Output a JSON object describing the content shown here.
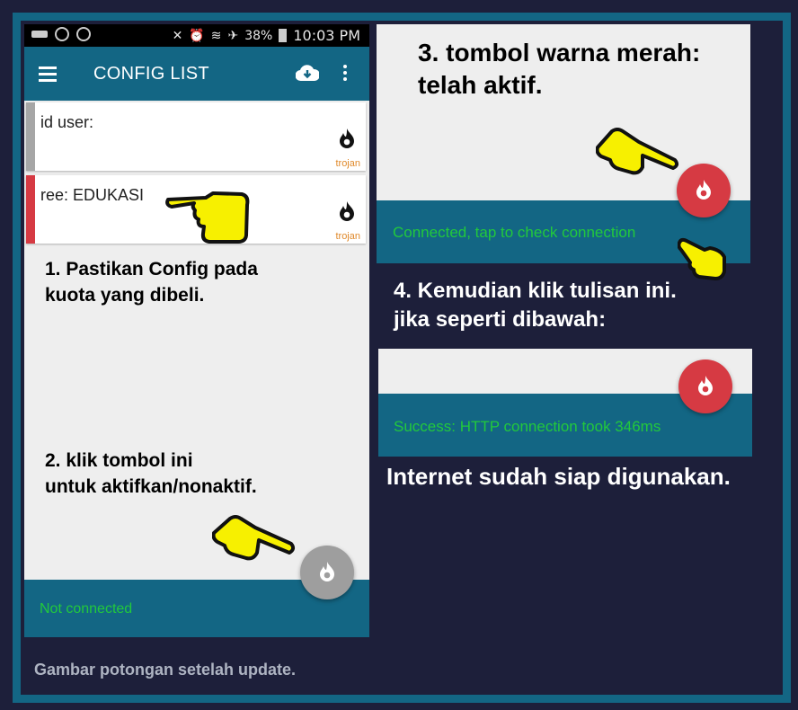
{
  "statusbar": {
    "battery": "38%",
    "time": "10:03 PM"
  },
  "appbar": {
    "title": "CONFIG LIST"
  },
  "configs": [
    {
      "name": "id user:",
      "tag": "trojan",
      "active": false
    },
    {
      "name": "ree: EDUKASI",
      "tag": "trojan",
      "active": true
    }
  ],
  "annotations": {
    "step1_line1": "1. Pastikan Config pada",
    "step1_line2": "kuota yang dibeli.",
    "step2_line1": "2. klik tombol ini",
    "step2_line2": "untuk aktifkan/nonaktif.",
    "step3_line1": "3. tombol warna merah:",
    "step3_line2": "telah aktif.",
    "step4_line1": "4. Kemudian klik tulisan ini.",
    "step4_line2": "jika seperti dibawah:",
    "final": "Internet sudah siap digunakan."
  },
  "status": {
    "left": "Not connected",
    "connected": "Connected, tap to check connection",
    "success": "Success: HTTP connection took 346ms"
  },
  "caption": "Gambar potongan setelah update.",
  "colors": {
    "primary": "#136684",
    "status_green": "#22c93c",
    "fab_active": "#d63a43",
    "fab_inactive": "#9e9e9e",
    "tag_orange": "#e08a2c",
    "pointer_yellow": "#f7f000"
  }
}
